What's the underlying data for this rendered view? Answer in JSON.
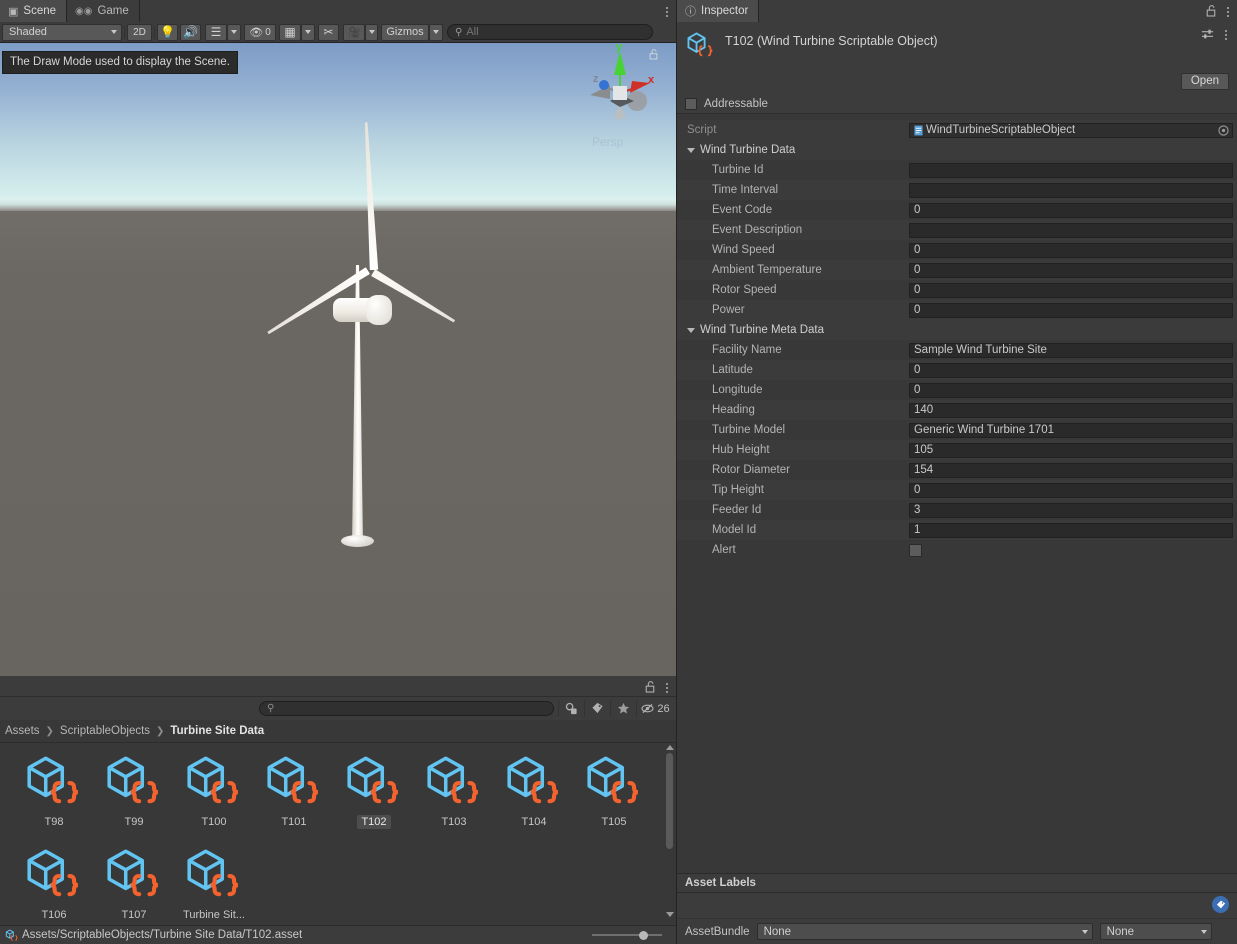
{
  "scene_panel": {
    "tabs": [
      {
        "label": "Scene",
        "icon": "grid-icon",
        "active": true
      },
      {
        "label": "Game",
        "icon": "gamepad-icon",
        "active": false
      }
    ],
    "toolbar": {
      "draw_mode": "Shaded",
      "two_d_label": "2D",
      "lighting_icon": "lightbulb-icon",
      "audio_icon": "speaker-icon",
      "fx_icon": "fx-stack-icon",
      "hidden_count": "0",
      "hidden_icon": "eye-off-icon",
      "grid_icon": "grid-y-icon",
      "tools_icon": "scissors-tool-icon",
      "camera_icon": "camera-icon",
      "gizmos_label": "Gizmos",
      "search_placeholder": "All",
      "search_value": "",
      "search_icon": "search-icon"
    },
    "tooltip": "The Draw Mode used to display the Scene.",
    "gizmo": {
      "x_label": "x",
      "y_label": "y",
      "z_label": "z",
      "projection": "Persp",
      "x_color": "#d32b1e",
      "y_color": "#44d62c",
      "z_color": "#2f6fd4",
      "lock_icon": "lock-open-icon"
    },
    "sky_top_color": "#7d9cc6",
    "sky_horizon_color": "#dff4f2",
    "ground_color": "#6b6763"
  },
  "project_panel": {
    "lock_icon": "lock-open-icon",
    "menu_icon": "kebab-menu-icon",
    "search_placeholder": "",
    "search_value": "",
    "search_icon": "search-icon",
    "filters": [
      {
        "name": "filter-by-type-icon",
        "label": ""
      },
      {
        "name": "filter-by-label-icon",
        "label": ""
      },
      {
        "name": "favorites-star-icon",
        "label": ""
      },
      {
        "name": "hidden-packages-icon",
        "label": "26"
      }
    ],
    "breadcrumb": [
      {
        "label": "Assets",
        "current": false
      },
      {
        "label": "ScriptableObjects",
        "current": false
      },
      {
        "label": "Turbine Site Data",
        "current": true
      }
    ],
    "assets": [
      {
        "label": "T98",
        "selected": false
      },
      {
        "label": "T99",
        "selected": false
      },
      {
        "label": "T100",
        "selected": false
      },
      {
        "label": "T101",
        "selected": false
      },
      {
        "label": "T102",
        "selected": true
      },
      {
        "label": "T103",
        "selected": false
      },
      {
        "label": "T104",
        "selected": false
      },
      {
        "label": "T105",
        "selected": false
      },
      {
        "label": "T106",
        "selected": false
      },
      {
        "label": "T107",
        "selected": false
      },
      {
        "label": "Turbine Sit...",
        "selected": false
      }
    ],
    "asset_icon": "scriptable-object-icon",
    "icon_cube_color": "#62c4f0",
    "icon_brace_color": "#f4622d"
  },
  "inspector": {
    "tab_label": "Inspector",
    "tab_icon": "info-icon",
    "lock_icon": "lock-open-icon",
    "menu_icon": "kebab-menu-icon",
    "preset_icon": "preset-sliders-icon",
    "object_title": "T102 (Wind Turbine Scriptable Object)",
    "object_icon": "scriptable-object-icon",
    "open_button": "Open",
    "addressable_label": "Addressable",
    "addressable_checked": false,
    "script_row": {
      "label": "Script",
      "value": "WindTurbineScriptableObject",
      "icon": "script-file-icon",
      "picker_icon": "object-picker-icon"
    },
    "sections": [
      {
        "title": "Wind Turbine Data",
        "expanded": true,
        "fields": [
          {
            "label": "Turbine Id",
            "value": "",
            "type": "text"
          },
          {
            "label": "Time Interval",
            "value": "",
            "type": "text"
          },
          {
            "label": "Event Code",
            "value": "0",
            "type": "number"
          },
          {
            "label": "Event Description",
            "value": "",
            "type": "text"
          },
          {
            "label": "Wind Speed",
            "value": "0",
            "type": "number"
          },
          {
            "label": "Ambient Temperature",
            "value": "0",
            "type": "number"
          },
          {
            "label": "Rotor Speed",
            "value": "0",
            "type": "number"
          },
          {
            "label": "Power",
            "value": "0",
            "type": "number"
          }
        ]
      },
      {
        "title": "Wind Turbine Meta Data",
        "expanded": true,
        "fields": [
          {
            "label": "Facility Name",
            "value": "Sample Wind Turbine Site",
            "type": "text"
          },
          {
            "label": "Latitude",
            "value": "0",
            "type": "number"
          },
          {
            "label": "Longitude",
            "value": "0",
            "type": "number"
          },
          {
            "label": "Heading",
            "value": "140",
            "type": "number"
          },
          {
            "label": "Turbine Model",
            "value": "Generic Wind Turbine 1701",
            "type": "text"
          },
          {
            "label": "Hub Height",
            "value": "105",
            "type": "number"
          },
          {
            "label": "Rotor Diameter",
            "value": "154",
            "type": "number"
          },
          {
            "label": "Tip Height",
            "value": "0",
            "type": "number"
          },
          {
            "label": "Feeder Id",
            "value": "3",
            "type": "number"
          },
          {
            "label": "Model Id",
            "value": "1",
            "type": "number"
          },
          {
            "label": "Alert",
            "value": "",
            "type": "checkbox",
            "checked": false
          }
        ]
      }
    ],
    "asset_labels": {
      "header": "Asset Labels",
      "tag_icon": "label-tag-icon",
      "assetbundle_label": "AssetBundle",
      "bundle_value": "None",
      "variant_value": "None"
    }
  },
  "statusbar": {
    "icon": "scriptable-object-icon",
    "path": "Assets/ScriptableObjects/Turbine Site Data/T102.asset"
  }
}
